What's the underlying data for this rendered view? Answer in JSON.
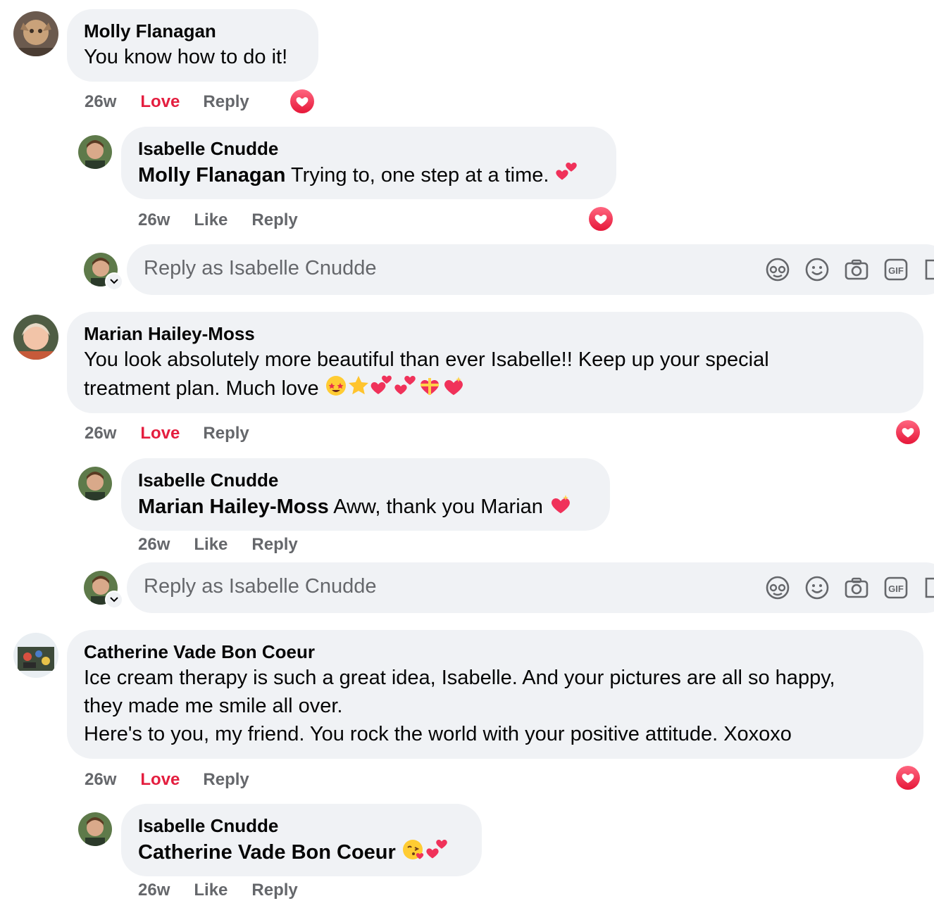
{
  "comments": [
    {
      "author": "Molly Flanagan",
      "text": "You know how to do it!",
      "time": "26w",
      "reaction_label": "Love",
      "reply_label": "Reply",
      "reply": {
        "author": "Isabelle Cnudde",
        "mention": "Molly Flanagan",
        "text": "Trying to, one step at a time.",
        "emojis": [
          "two-hearts"
        ],
        "time": "26w",
        "like_label": "Like",
        "reply_label": "Reply"
      },
      "reply_box_placeholder": "Reply as Isabelle Cnudde"
    },
    {
      "author": "Marian Hailey-Moss",
      "text_line1": "You look absolutely more beautiful than ever Isabelle!! Keep up your special",
      "text_line2": "treatment plan. Much love",
      "emojis": [
        "star-struck",
        "star",
        "revolving-hearts",
        "two-hearts",
        "heart-with-ribbon",
        "sparkling-heart"
      ],
      "time": "26w",
      "reaction_label": "Love",
      "reply_label": "Reply",
      "reply": {
        "author": "Isabelle Cnudde",
        "mention": "Marian Hailey-Moss",
        "text": "Aww, thank you Marian",
        "emojis": [
          "sparkling-heart"
        ],
        "time": "26w",
        "like_label": "Like",
        "reply_label": "Reply"
      },
      "reply_box_placeholder": "Reply as Isabelle Cnudde"
    },
    {
      "author": "Catherine Vade Bon Coeur",
      "text_line1": "Ice cream therapy is such a great idea, Isabelle. And your pictures are all so happy,",
      "text_line2": "they made me smile all over.",
      "text_line3": "Here's to you, my friend. You rock the world with your positive attitude. Xoxoxo",
      "time": "26w",
      "reaction_label": "Love",
      "reply_label": "Reply",
      "reply": {
        "author": "Isabelle Cnudde",
        "mention": "Catherine Vade Bon Coeur",
        "text": "",
        "emojis": [
          "face-blowing-kiss",
          "two-hearts"
        ],
        "time": "26w",
        "like_label": "Like",
        "reply_label": "Reply"
      }
    }
  ],
  "reply_box_icons": [
    "avatar-sticker-icon",
    "emoji-icon",
    "camera-icon",
    "gif-icon",
    "sticker-icon"
  ],
  "colors": {
    "bubble": "#f0f2f5",
    "secondary_text": "#65676b",
    "love": "#e41e3f"
  }
}
